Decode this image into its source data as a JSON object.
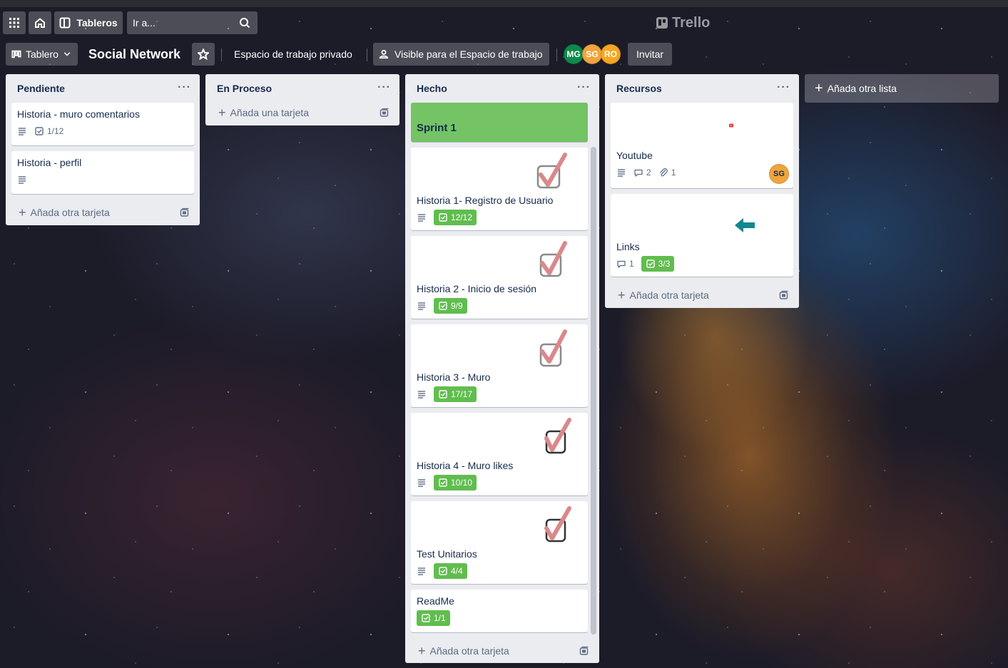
{
  "top_bar": {
    "boards_label": "Tableros",
    "search_placeholder": "Ir a...",
    "logo_text": "Trello",
    "icons": [
      "apps-grid-icon",
      "home-icon",
      "boards-icon",
      "search-icon"
    ]
  },
  "board_header": {
    "view_label": "Tablero",
    "board_title": "Social Network",
    "workspace_label": "Espacio de trabajo privado",
    "visibility_label": "Visible para el Espacio de trabajo",
    "members": [
      {
        "initials": "MG",
        "color": "#0b8a4a"
      },
      {
        "initials": "SG",
        "color": "#f2a43b"
      },
      {
        "initials": "RO",
        "color": "#f5a623"
      }
    ],
    "invite_label": "Invitar"
  },
  "lists": {
    "pendiente": {
      "title": "Pendiente",
      "cards": [
        {
          "title": "Historia - muro comentarios",
          "checklist": "1/12"
        },
        {
          "title": "Historia - perfil"
        }
      ],
      "add_label": "Añada otra tarjeta"
    },
    "en_proceso": {
      "title": "En Proceso",
      "add_label": "Añada una tarjeta"
    },
    "hecho": {
      "title": "Hecho",
      "cards": [
        {
          "title": "Sprint 1",
          "cover_color": "#74c365"
        },
        {
          "title": "Historia 1- Registro de Usuario",
          "checklist": "12/12"
        },
        {
          "title": "Historia 2 - Inicio de sesión",
          "checklist": "9/9"
        },
        {
          "title": "Historia 3 - Muro",
          "checklist": "17/17"
        },
        {
          "title": "Historia 4 - Muro likes",
          "checklist": "10/10"
        },
        {
          "title": "Test Unitarios",
          "checklist": "4/4"
        },
        {
          "title": "ReadMe",
          "checklist": "1/1"
        }
      ],
      "add_label": "Añada otra tarjeta"
    },
    "recursos": {
      "title": "Recursos",
      "cards": [
        {
          "title": "Youtube",
          "comments": "2",
          "attachments": "1",
          "member": "SG"
        },
        {
          "title": "Links",
          "comments": "1",
          "checklist": "3/3"
        }
      ],
      "add_label": "Añada otra tarjeta"
    }
  },
  "add_list_label": "Añada otra lista",
  "colors": {
    "done_badge": "#61bd4f",
    "list_bg": "#ebecf0",
    "check_art": "#d9898b",
    "arrow": "#12878f"
  }
}
